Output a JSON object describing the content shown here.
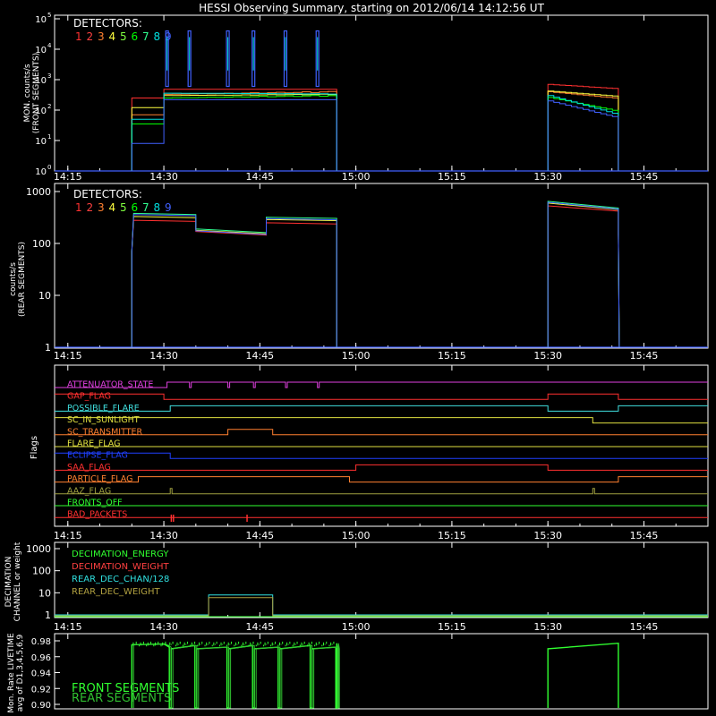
{
  "title": "HESSI Observing Summary, starting on 2012/06/14 14:12:56 UT",
  "colors": {
    "background": "#000000",
    "axes": "#ffffff",
    "det": [
      "#ff3030",
      "#ff4040",
      "#ff8030",
      "#ffff40",
      "#80ff40",
      "#00ff00",
      "#30ff90",
      "#00e0e0",
      "#4060ff"
    ],
    "flags": [
      "#e040e0",
      "#ff3030",
      "#40e0e0",
      "#e0e040",
      "#ff8030",
      "#e0e040",
      "#2040ff",
      "#ff3030",
      "#ff8030",
      "#a0a040",
      "#30ff30",
      "#ff3030"
    ],
    "decim": [
      "#30ff30",
      "#ff4040",
      "#30e0e0",
      "#b0a040"
    ],
    "livetime": [
      "#30ff30",
      "#30c030"
    ]
  },
  "time_axis": {
    "tick_labels": [
      "14:15",
      "14:30",
      "14:45",
      "15:00",
      "15:15",
      "15:30",
      "15:45"
    ]
  },
  "panels": {
    "front": {
      "ylabel_lines": [
        "MON. counts/s",
        "(FRONT SEGMENTS)"
      ],
      "ytick_base": "10",
      "ytick_exps": [
        "0",
        "1",
        "2",
        "3",
        "4",
        "5"
      ],
      "detectors_label": "DETECTORS:",
      "detector_numbers": [
        "1",
        "2",
        "3",
        "4",
        "5",
        "6",
        "7",
        "8",
        "9"
      ]
    },
    "rear": {
      "ylabel_lines": [
        "counts/s",
        "(REAR SEGMENTS)"
      ],
      "ytick_labels": [
        "1",
        "10",
        "100",
        "1000"
      ],
      "detectors_label": "DETECTORS:",
      "detector_numbers": [
        "1",
        "2",
        "3",
        "4",
        "5",
        "6",
        "7",
        "8",
        "9"
      ]
    },
    "flags": {
      "ylabel": "Flags",
      "names": [
        "ATTENUATOR_STATE",
        "GAP_FLAG",
        "POSSIBLE_FLARE",
        "SC_IN_SUNLIGHT",
        "SC_TRANSMITTER",
        "FLARE_FLAG",
        "ECLIPSE_FLAG",
        "SAA_FLAG",
        "PARTICLE_FLAG",
        "AAZ_FLAG",
        "FRONTS_OFF",
        "BAD_PACKETS"
      ]
    },
    "decimation": {
      "ylabel_lines": [
        "DECIMATION",
        "CHANNEL or weight"
      ],
      "ytick_labels": [
        "1",
        "10",
        "100",
        "1000"
      ],
      "legend": [
        "DECIMATION_ENERGY",
        "DECIMATION_WEIGHT",
        "REAR_DEC_CHAN/128",
        "REAR_DEC_WEIGHT"
      ]
    },
    "livetime": {
      "ylabel_lines": [
        "Mon. Rate LIVETIME",
        "avg of D1,3,4,5,6,9"
      ],
      "ytick_labels": [
        "0.90",
        "0.92",
        "0.94",
        "0.96",
        "0.98"
      ],
      "legend": [
        "FRONT SEGMENTS",
        "REAR SEGMENTS"
      ]
    }
  },
  "chart_data": [
    {
      "type": "line",
      "panel": "front",
      "x_unit": "UT time",
      "xlim": [
        "14:12:56",
        "15:55"
      ],
      "ylim": [
        1,
        100000
      ],
      "yscale": "log",
      "series": [
        {
          "name": "1",
          "values": [
            {
              "x": "14:25",
              "y": 1
            },
            {
              "x": "14:25",
              "y": 200
            },
            {
              "x": "14:31",
              "y": 400
            },
            {
              "x": "14:45",
              "y": 550
            },
            {
              "x": "14:57",
              "y": 500
            },
            {
              "x": "14:57",
              "y": 1
            },
            {
              "x": "15:30",
              "y": 1
            },
            {
              "x": "15:30",
              "y": 700
            },
            {
              "x": "15:41",
              "y": 500
            },
            {
              "x": "15:41",
              "y": 1
            }
          ]
        },
        {
          "name": "3",
          "values": [
            {
              "x": "14:25",
              "y": 1
            },
            {
              "x": "14:25",
              "y": 100
            },
            {
              "x": "14:31",
              "y": 300
            },
            {
              "x": "14:45",
              "y": 450
            },
            {
              "x": "14:57",
              "y": 380
            },
            {
              "x": "14:57",
              "y": 1
            },
            {
              "x": "15:30",
              "y": 1
            },
            {
              "x": "15:30",
              "y": 400
            },
            {
              "x": "15:41",
              "y": 250
            },
            {
              "x": "15:41",
              "y": 1
            }
          ]
        },
        {
          "name": "9",
          "values": [
            {
              "x": "14:25",
              "y": 1
            },
            {
              "x": "14:25",
              "y": 40
            },
            {
              "x": "14:31",
              "y": 200
            },
            {
              "x": "14:45",
              "y": 350
            },
            {
              "x": "14:57",
              "y": 250
            },
            {
              "x": "14:57",
              "y": 1
            },
            {
              "x": "15:30",
              "y": 1
            },
            {
              "x": "15:30",
              "y": 250
            },
            {
              "x": "15:41",
              "y": 70
            },
            {
              "x": "15:41",
              "y": 1
            }
          ]
        }
      ]
    },
    {
      "type": "line",
      "panel": "rear",
      "x_unit": "UT time",
      "ylim": [
        1,
        1000
      ],
      "yscale": "log",
      "series": [
        {
          "name": "1",
          "values": [
            {
              "x": "14:25",
              "y": 1
            },
            {
              "x": "14:25",
              "y": 300
            },
            {
              "x": "14:35",
              "y": 180
            },
            {
              "x": "14:46",
              "y": 290
            },
            {
              "x": "14:57",
              "y": 290
            },
            {
              "x": "14:57",
              "y": 1
            },
            {
              "x": "15:30",
              "y": 1
            },
            {
              "x": "15:30",
              "y": 550
            },
            {
              "x": "15:41",
              "y": 430
            },
            {
              "x": "15:41",
              "y": 1
            }
          ]
        },
        {
          "name": "8",
          "values": [
            {
              "x": "14:25",
              "y": 1
            },
            {
              "x": "14:25",
              "y": 400
            },
            {
              "x": "14:35",
              "y": 190
            },
            {
              "x": "14:46",
              "y": 330
            },
            {
              "x": "14:57",
              "y": 320
            },
            {
              "x": "14:57",
              "y": 1
            },
            {
              "x": "15:30",
              "y": 1
            },
            {
              "x": "15:30",
              "y": 650
            },
            {
              "x": "15:41",
              "y": 480
            },
            {
              "x": "15:41",
              "y": 1
            }
          ]
        }
      ]
    },
    {
      "type": "line",
      "panel": "livetime",
      "x_unit": "UT time",
      "ylim": [
        0.9,
        0.99
      ],
      "series": [
        {
          "name": "FRONT SEGMENTS",
          "values": [
            {
              "x": "14:25",
              "y": 0.975
            },
            {
              "x": "14:57",
              "y": 0.977
            },
            {
              "x": "15:30",
              "y": 0.972
            },
            {
              "x": "15:41",
              "y": 0.977
            }
          ]
        }
      ]
    }
  ]
}
